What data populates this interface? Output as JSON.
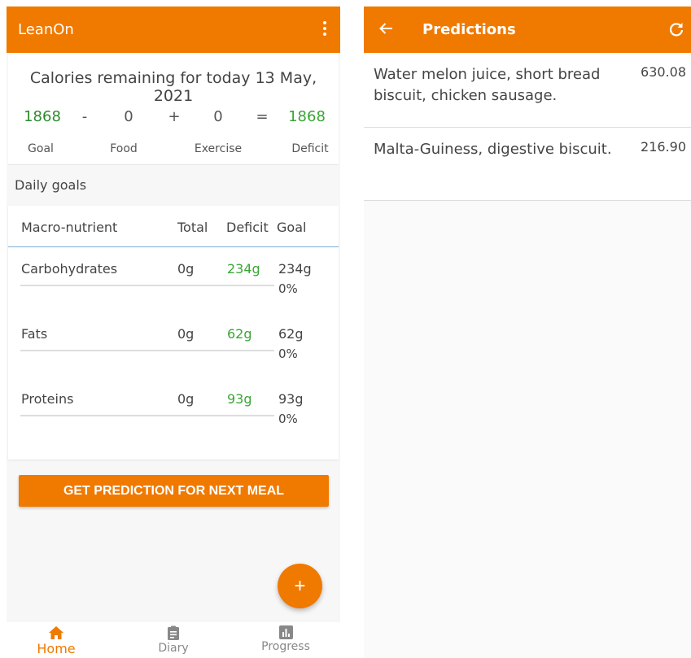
{
  "home": {
    "app_title": "LeanOn",
    "calories": {
      "heading": "Calories remaining for today 13 May, 2021",
      "goal": "1868",
      "minus": "-",
      "food": "0",
      "plus": "+",
      "exercise": "0",
      "equals": "=",
      "deficit": "1868",
      "labels": {
        "goal": "Goal",
        "food": "Food",
        "exercise": "Exercise",
        "deficit": "Deficit"
      }
    },
    "daily_goals_title": "Daily goals",
    "macro_table": {
      "headers": {
        "name": "Macro-nutrient",
        "total": "Total",
        "deficit": "Deficit",
        "goal": "Goal"
      },
      "rows": [
        {
          "name": "Carbohydrates",
          "total": "0g",
          "deficit": "234g",
          "goal": "234g",
          "percent": "0%",
          "progress": 0
        },
        {
          "name": "Fats",
          "total": "0g",
          "deficit": "62g",
          "goal": "62g",
          "percent": "0%",
          "progress": 0
        },
        {
          "name": "Proteins",
          "total": "0g",
          "deficit": "93g",
          "goal": "93g",
          "percent": "0%",
          "progress": 0
        }
      ]
    },
    "predict_button": "GET PREDICTION FOR NEXT MEAL",
    "fab_label": "+",
    "nav": [
      {
        "label": "Home",
        "icon": "home-icon",
        "active": true
      },
      {
        "label": "Diary",
        "icon": "clipboard-icon",
        "active": false
      },
      {
        "label": "Progress",
        "icon": "bar-chart-icon",
        "active": false
      }
    ]
  },
  "predictions": {
    "title": "Predictions",
    "items": [
      {
        "text": "Water melon juice, short bread biscuit, chicken sausage.",
        "value": "630.08"
      },
      {
        "text": "Malta-Guiness, digestive biscuit.",
        "value": "216.90"
      }
    ]
  },
  "colors": {
    "accent": "#f07900",
    "deficit_green": "#3aa535"
  }
}
